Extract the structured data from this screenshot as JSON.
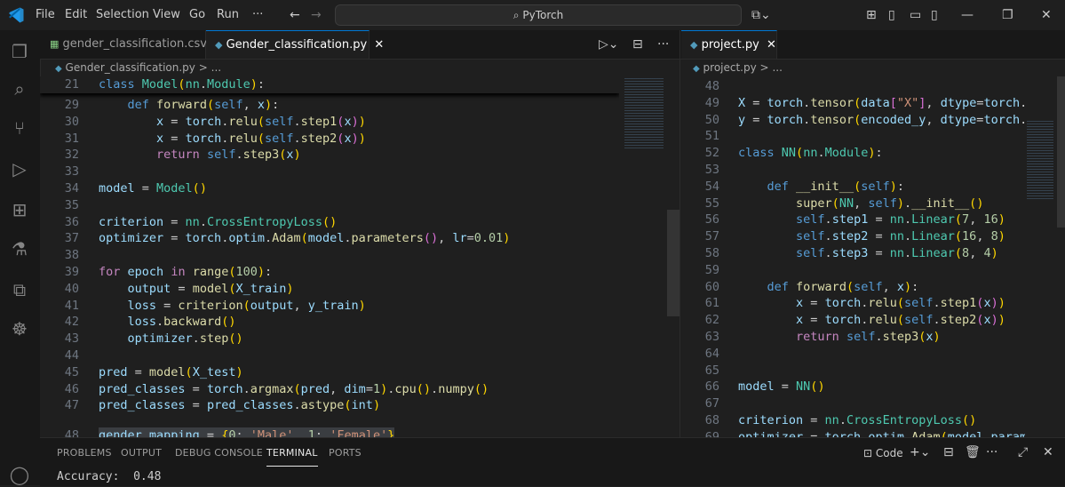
{
  "menu": [
    "File",
    "Edit",
    "Selection",
    "View",
    "Go",
    "Run",
    "···"
  ],
  "search": {
    "label": "PyTorch"
  },
  "icons": {
    "app": "vscode-logo-icon",
    "back": "arrow-left-icon",
    "forward": "arrow-right-icon",
    "search": "search-icon",
    "copilot": "copilot-icon"
  },
  "left_editor": {
    "tabs": [
      {
        "label": "gender_classification.csv",
        "icon": "csv-file-icon",
        "active": false
      },
      {
        "label": "Gender_classification.py",
        "icon": "python-file-icon",
        "active": true
      }
    ],
    "breadcrumb": {
      "file": "Gender_classification.py",
      "sep": ">",
      "more": "..."
    },
    "sticky": {
      "num": "21",
      "text": "class Model(nn.Module):"
    },
    "lines": [
      {
        "num": "29",
        "text": "    def forward(self, x):"
      },
      {
        "num": "30",
        "text": "        x = torch.relu(self.step1(x))"
      },
      {
        "num": "31",
        "text": "        x = torch.relu(self.step2(x))"
      },
      {
        "num": "32",
        "text": "        return self.step3(x)"
      },
      {
        "num": "33",
        "text": ""
      },
      {
        "num": "34",
        "text": "model = Model()"
      },
      {
        "num": "35",
        "text": ""
      },
      {
        "num": "36",
        "text": "criterion = nn.CrossEntropyLoss()"
      },
      {
        "num": "37",
        "text": "optimizer = torch.optim.Adam(model.parameters(), lr=0.01)"
      },
      {
        "num": "38",
        "text": ""
      },
      {
        "num": "39",
        "text": "for epoch in range(100):"
      },
      {
        "num": "40",
        "text": "    output = model(X_train)"
      },
      {
        "num": "41",
        "text": "    loss = criterion(output, y_train)"
      },
      {
        "num": "42",
        "text": "    loss.backward()"
      },
      {
        "num": "43",
        "text": "    optimizer.step()"
      },
      {
        "num": "44",
        "text": ""
      },
      {
        "num": "45",
        "text": "pred = model(X_test)"
      },
      {
        "num": "46",
        "text": "pred_classes = torch.argmax(pred, dim=1).cpu().numpy()"
      },
      {
        "num": "47",
        "text": "pred_classes = pred_classes.astype(int)"
      },
      {
        "num": "48",
        "text": "gender_mapping = {0: 'Male', 1: 'Female'}"
      }
    ]
  },
  "right_editor": {
    "tabs": [
      {
        "label": "project.py",
        "icon": "python-file-icon",
        "active": true
      }
    ],
    "breadcrumb": {
      "file": "project.py",
      "sep": ">",
      "more": "..."
    },
    "lines": [
      {
        "num": "48",
        "text": ""
      },
      {
        "num": "49",
        "text": "X = torch.tensor(data[\"X\"], dtype=torch.fl"
      },
      {
        "num": "50",
        "text": "y = torch.tensor(encoded_y, dtype=torch.fl"
      },
      {
        "num": "51",
        "text": ""
      },
      {
        "num": "52",
        "text": "class NN(nn.Module):"
      },
      {
        "num": "53",
        "text": ""
      },
      {
        "num": "54",
        "text": "    def __init__(self):"
      },
      {
        "num": "55",
        "text": "        super(NN, self).__init__()"
      },
      {
        "num": "56",
        "text": "        self.step1 = nn.Linear(7, 16)"
      },
      {
        "num": "57",
        "text": "        self.step2 = nn.Linear(16, 8)"
      },
      {
        "num": "58",
        "text": "        self.step3 = nn.Linear(8, 4)"
      },
      {
        "num": "59",
        "text": ""
      },
      {
        "num": "60",
        "text": "    def forward(self, x):"
      },
      {
        "num": "61",
        "text": "        x = torch.relu(self.step1(x))"
      },
      {
        "num": "62",
        "text": "        x = torch.relu(self.step2(x))"
      },
      {
        "num": "63",
        "text": "        return self.step3(x)"
      },
      {
        "num": "64",
        "text": ""
      },
      {
        "num": "65",
        "text": ""
      },
      {
        "num": "66",
        "text": "model = NN()"
      },
      {
        "num": "67",
        "text": ""
      },
      {
        "num": "68",
        "text": "criterion = nn.CrossEntropyLoss()"
      },
      {
        "num": "69",
        "text": "optimizer = torch.optim.Adam(model.paramet"
      }
    ]
  },
  "panel": {
    "tabs": [
      "PROBLEMS",
      "OUTPUT",
      "DEBUG CONSOLE",
      "TERMINAL",
      "PORTS"
    ],
    "active": "TERMINAL",
    "terminal_profile": "Code",
    "output": "Accuracy:  0.48"
  }
}
